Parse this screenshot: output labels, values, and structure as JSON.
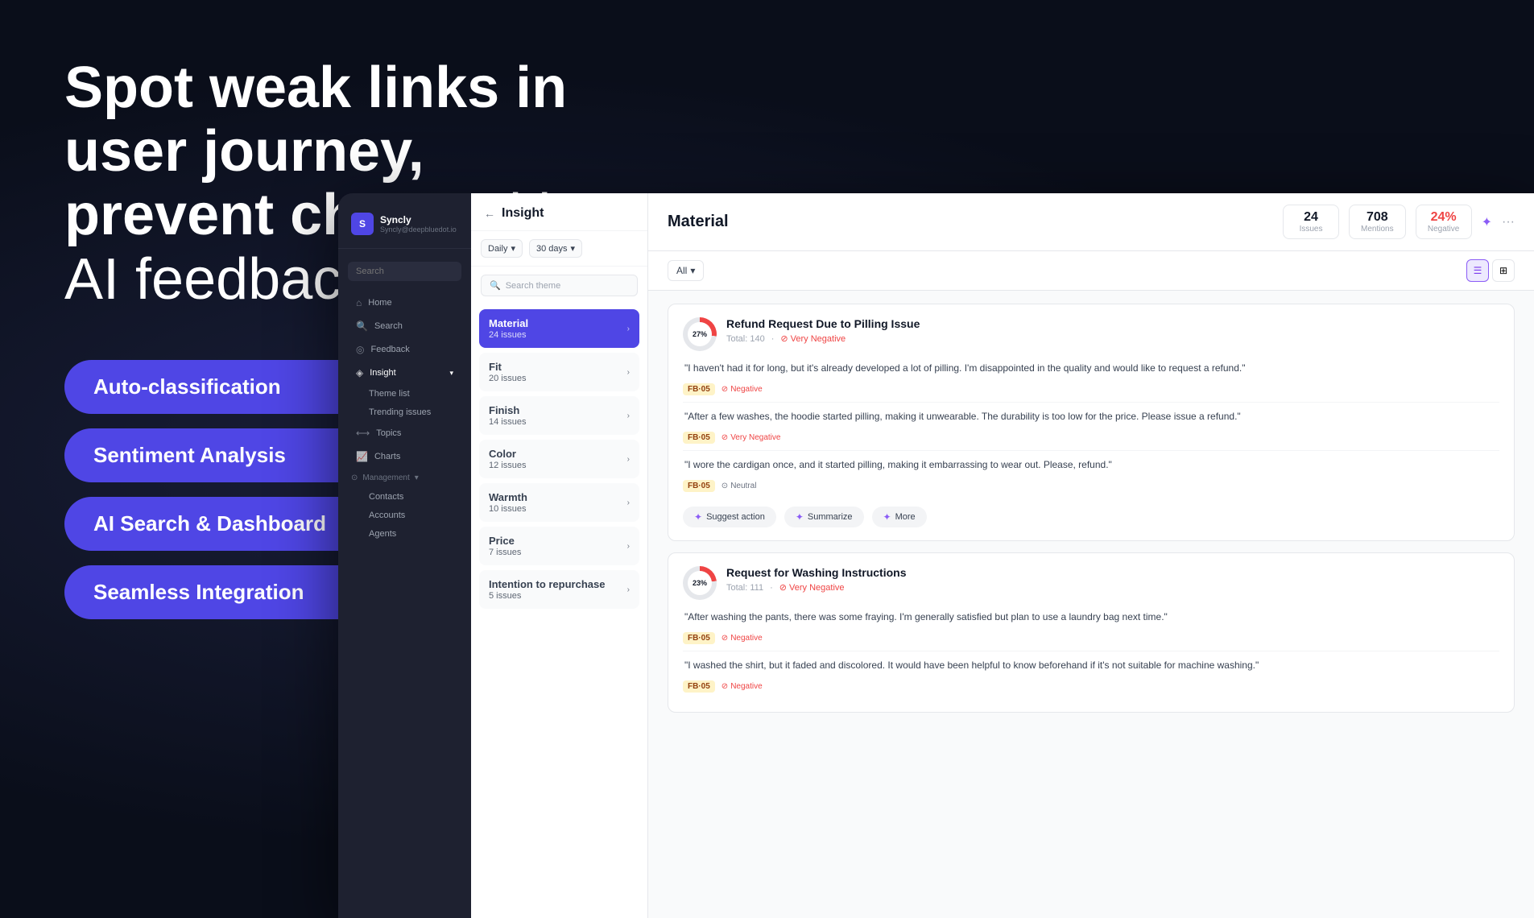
{
  "hero": {
    "title_bold": "Spot weak links in user journey,\nprevent churn",
    "title_normal": " with AI feedback analysis"
  },
  "badges": [
    {
      "id": "auto-classification",
      "label": "Auto-classification"
    },
    {
      "id": "sentiment-analysis",
      "label": "Sentiment Analysis"
    },
    {
      "id": "ai-search",
      "label": "AI Search & Dashboard"
    },
    {
      "id": "seamless-integration",
      "label": "Seamless Integration"
    }
  ],
  "sidebar": {
    "brand_name": "Syncly",
    "brand_email": "Syncly@deepbluedot.io",
    "search_placeholder": "Search",
    "nav_items": [
      {
        "id": "home",
        "icon": "⌂",
        "label": "Home"
      },
      {
        "id": "search",
        "icon": "🔍",
        "label": "Search"
      },
      {
        "id": "feedback",
        "icon": "◎",
        "label": "Feedback"
      },
      {
        "id": "insight",
        "icon": "◈",
        "label": "Insight",
        "expandable": true
      },
      {
        "id": "theme-list",
        "label": "Theme list",
        "sub": true
      },
      {
        "id": "trending-issues",
        "label": "Trending issues",
        "sub": true
      },
      {
        "id": "topics",
        "icon": "⟷",
        "label": "Topics"
      },
      {
        "id": "charts",
        "icon": "📈",
        "label": "Charts"
      },
      {
        "id": "management",
        "icon": "⊙",
        "label": "Management",
        "expandable": true
      },
      {
        "id": "contacts",
        "label": "Contacts",
        "sub": true
      },
      {
        "id": "accounts",
        "label": "Accounts",
        "sub": true
      },
      {
        "id": "agents",
        "label": "Agents",
        "sub": true
      }
    ]
  },
  "insight_panel": {
    "title": "Insight",
    "filter_daily": "Daily",
    "filter_days": "30 days",
    "search_placeholder": "Search theme",
    "themes": [
      {
        "id": "material",
        "name": "Material",
        "count": "24 issues",
        "active": true
      },
      {
        "id": "fit",
        "name": "Fit",
        "count": "20 issues",
        "active": false
      },
      {
        "id": "finish",
        "name": "Finish",
        "count": "14 issues",
        "active": false
      },
      {
        "id": "color",
        "name": "Color",
        "count": "12 issues",
        "active": false
      },
      {
        "id": "warmth",
        "name": "Warmth",
        "count": "10 issues",
        "active": false
      },
      {
        "id": "price",
        "name": "Price",
        "count": "7 issues",
        "active": false
      },
      {
        "id": "intention",
        "name": "Intention to repurchase",
        "count": "5 issues",
        "active": false
      }
    ]
  },
  "main": {
    "title": "Material",
    "stats": {
      "issues_value": "24",
      "issues_label": "Issues",
      "mentions_value": "708",
      "mentions_label": "Mentions",
      "negative_value": "24%",
      "negative_label": "Negative"
    },
    "filter_all": "All",
    "feedback_cards": [
      {
        "id": "card1",
        "pct": "27%",
        "pct_num": 27,
        "issue_title": "Refund Request Due to Pilling Issue",
        "total": "Total: 140",
        "sentiment_header": "Very Negative",
        "quotes": [
          {
            "text": "\"I haven't had it for long, but it's already developed a lot of pilling. I'm disappointed in the quality and would like to request a refund.\"",
            "tag": "FB·05",
            "sentiment": "Negative",
            "sentiment_type": "neg"
          },
          {
            "text": "\"After a few washes, the hoodie started pilling, making it unwearable. The durability is too low for the price. Please issue a refund.\"",
            "tag": "FB·05",
            "sentiment": "Very Negative",
            "sentiment_type": "neg"
          },
          {
            "text": "\"I wore the cardigan once, and it started pilling, making it embarrassing to wear out. Please, refund.\"",
            "tag": "FB·05",
            "sentiment": "Neutral",
            "sentiment_type": "neutral"
          }
        ],
        "actions": [
          "Suggest action",
          "Summarize",
          "More"
        ]
      },
      {
        "id": "card2",
        "pct": "23%",
        "pct_num": 23,
        "issue_title": "Request for Washing Instructions",
        "total": "Total: 111",
        "sentiment_header": "Very Negative",
        "quotes": [
          {
            "text": "\"After washing the pants, there was some fraying. I'm generally satisfied but plan to use a laundry bag next time.\"",
            "tag": "FB·05",
            "sentiment": "Negative",
            "sentiment_type": "neg"
          },
          {
            "text": "\"I washed the shirt, but it faded and discolored. It would have been helpful to know beforehand if it's not suitable for machine washing.\"",
            "tag": "FB·05",
            "sentiment": "Negative",
            "sentiment_type": "neg"
          }
        ],
        "actions": []
      }
    ]
  }
}
